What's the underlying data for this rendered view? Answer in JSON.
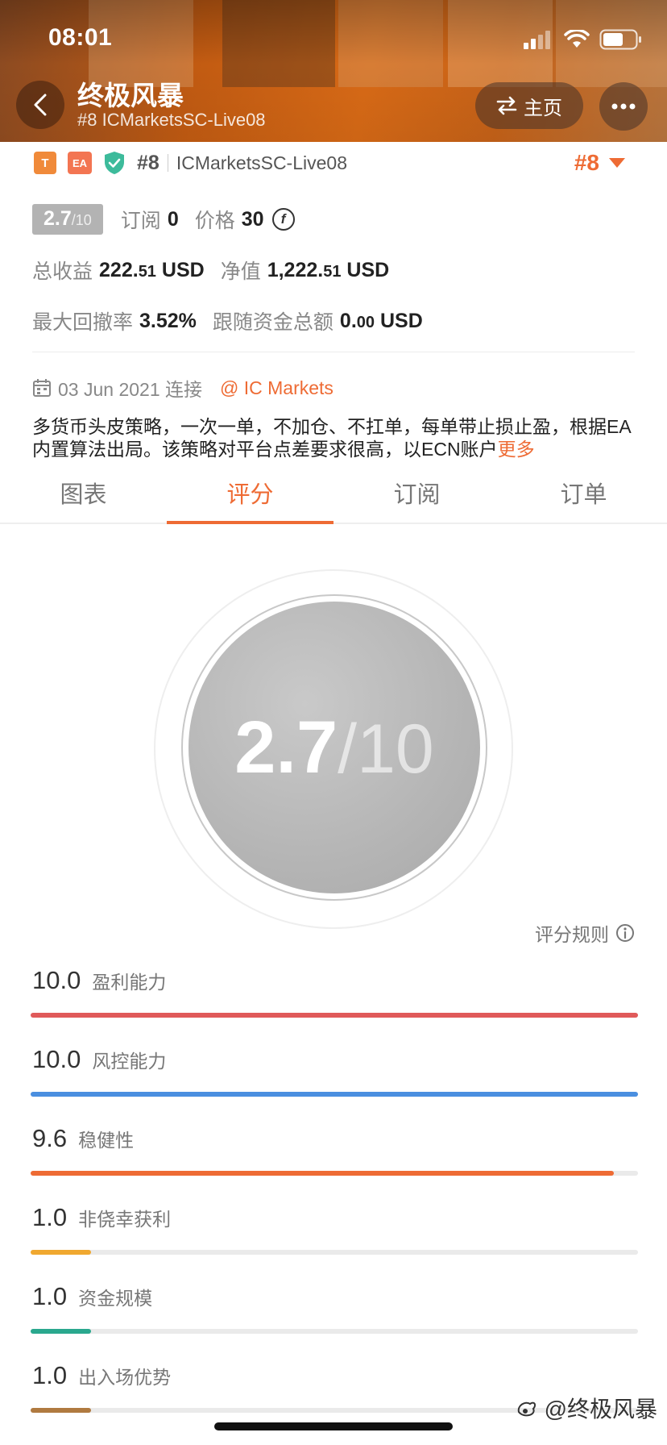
{
  "status_bar": {
    "time": "08:01"
  },
  "header": {
    "title": "终极风暴",
    "subtitle": "#8 ICMarketsSC-Live08",
    "home_label": "主页"
  },
  "tags": {
    "t": "T",
    "ea": "EA",
    "rank": "#8",
    "server": "ICMarketsSC-Live08",
    "rank_right": "#8"
  },
  "metrics": {
    "score": "2.7",
    "score_total": "/10",
    "subscribe_label": "订阅",
    "subscribe_value": "0",
    "price_label": "价格",
    "price_value": "30",
    "coin_symbol": "f",
    "total_profit_label": "总收益",
    "total_profit_int": "222.",
    "total_profit_dec": "51",
    "total_profit_unit": "USD",
    "equity_label": "净值",
    "equity_int": "1,222.",
    "equity_dec": "51",
    "equity_unit": "USD",
    "max_drawdown_label": "最大回撤率",
    "max_drawdown_value": "3.52%",
    "follow_funds_label": "跟随资金总额",
    "follow_funds_int": "0.",
    "follow_funds_dec": "00",
    "follow_funds_unit": "USD"
  },
  "connection": {
    "date": "03 Jun 2021 连接",
    "broker": "@ IC Markets"
  },
  "description": {
    "text": "多货币头皮策略，一次一单，不加仓、不扛单，每单带止损止盈，根据EA内置算法出局。该策略对平台点差要求很高，以ECN账户",
    "more": "更多"
  },
  "tabs": [
    {
      "label": "图表",
      "active": false
    },
    {
      "label": "评分",
      "active": true
    },
    {
      "label": "订阅",
      "active": false
    },
    {
      "label": "订单",
      "active": false
    }
  ],
  "ring": {
    "score": "2.7",
    "total": "/10"
  },
  "rules_label": "评分规则",
  "score_items": [
    {
      "value": "10.0",
      "label": "盈利能力",
      "fraction": 1.0,
      "color": "#e05a5a"
    },
    {
      "value": "10.0",
      "label": "风控能力",
      "fraction": 1.0,
      "color": "#4a8fe0"
    },
    {
      "value": "9.6",
      "label": "稳健性",
      "fraction": 0.96,
      "color": "#ee6b34"
    },
    {
      "value": "1.0",
      "label": "非侥幸获利",
      "fraction": 0.1,
      "color": "#f0a830"
    },
    {
      "value": "1.0",
      "label": "资金规模",
      "fraction": 0.1,
      "color": "#2aa88e"
    },
    {
      "value": "1.0",
      "label": "出入场优势",
      "fraction": 0.1,
      "color": "#b07a40"
    }
  ],
  "watermark": "@终极风暴"
}
